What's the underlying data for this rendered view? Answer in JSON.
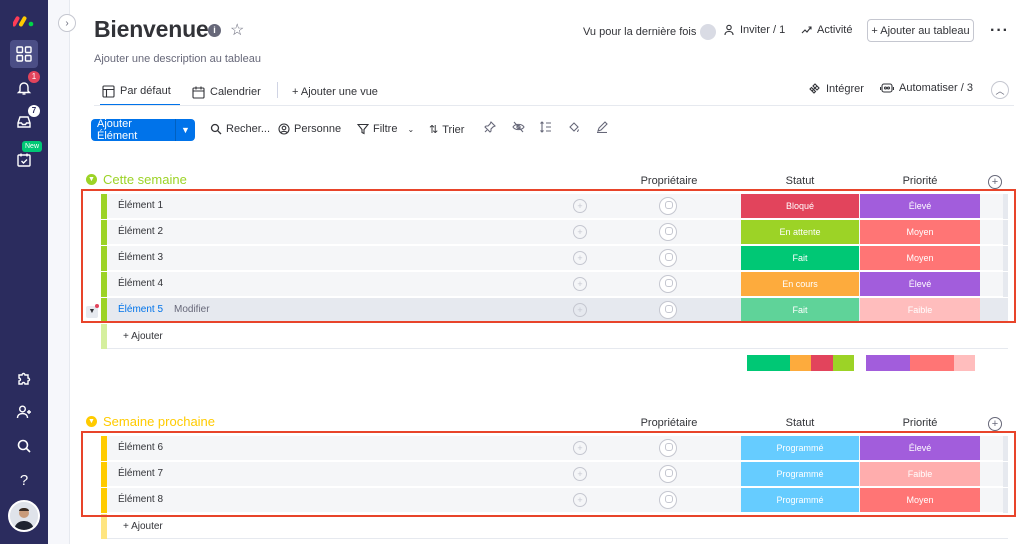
{
  "header": {
    "title": "Bienvenue",
    "description": "Ajouter une description au tableau",
    "last_seen": "Vu pour la dernière fois",
    "invite": "Inviter / 1",
    "activity": "Activité",
    "add_to_board": "+ Ajouter au tableau"
  },
  "rail": {
    "notifications_badge": "1",
    "inbox_badge": "7",
    "new_badge": "New"
  },
  "tabs": {
    "default": "Par défaut",
    "calendar": "Calendrier",
    "add_view": "+ Ajouter une vue",
    "integrate": "Intégrer",
    "automate": "Automatiser / 3"
  },
  "toolbar": {
    "new_item": "Ajouter Élément",
    "search": "Recher...",
    "person": "Personne",
    "filter": "Filtre",
    "sort": "Trier"
  },
  "columns": {
    "owner": "Propriétaire",
    "status": "Statut",
    "priority": "Priorité"
  },
  "groups": [
    {
      "title": "Cette semaine",
      "color": "#9cd326",
      "add_label": "+ Ajouter",
      "rows": [
        {
          "name": "Élément 1",
          "status": "Bloqué",
          "status_color": "#e2445c",
          "priority": "Élevé",
          "priority_color": "#a25ddc"
        },
        {
          "name": "Élément 2",
          "status": "En attente",
          "status_color": "#9cd326",
          "priority": "Moyen",
          "priority_color": "#ff7575"
        },
        {
          "name": "Élément 3",
          "status": "Fait",
          "status_color": "#00c875",
          "priority": "Moyen",
          "priority_color": "#ff7575"
        },
        {
          "name": "Élément 4",
          "status": "En cours",
          "status_color": "#fdab3d",
          "priority": "Élevé",
          "priority_color": "#a25ddc"
        },
        {
          "name": "Élément 5",
          "edit_label": "Modifier",
          "status": "Fait",
          "status_color": "#5fd399",
          "priority": "Faible",
          "priority_color": "#ffbdbd"
        }
      ]
    },
    {
      "title": "Semaine prochaine",
      "color": "#ffcb00",
      "add_label": "+ Ajouter",
      "rows": [
        {
          "name": "Élément 6",
          "status": "Programmé",
          "status_color": "#66ccff",
          "priority": "Élevé",
          "priority_color": "#a25ddc"
        },
        {
          "name": "Élément 7",
          "status": "Programmé",
          "status_color": "#66ccff",
          "priority": "Faible",
          "priority_color": "#ffadad"
        },
        {
          "name": "Élément 8",
          "status": "Programmé",
          "status_color": "#66ccff",
          "priority": "Moyen",
          "priority_color": "#ff7575"
        }
      ]
    }
  ],
  "summary": {
    "status_segments": [
      {
        "color": "#00c875",
        "share": 0.4
      },
      {
        "color": "#fdab3d",
        "share": 0.2
      },
      {
        "color": "#e2445c",
        "share": 0.2
      },
      {
        "color": "#9cd326",
        "share": 0.2
      }
    ],
    "priority_segments": [
      {
        "color": "#a25ddc",
        "share": 0.4
      },
      {
        "color": "#ff7575",
        "share": 0.4
      },
      {
        "color": "#ffbdbd",
        "share": 0.2
      }
    ]
  },
  "accent_color": "#0073ea",
  "highlight_color": "#e8442a"
}
